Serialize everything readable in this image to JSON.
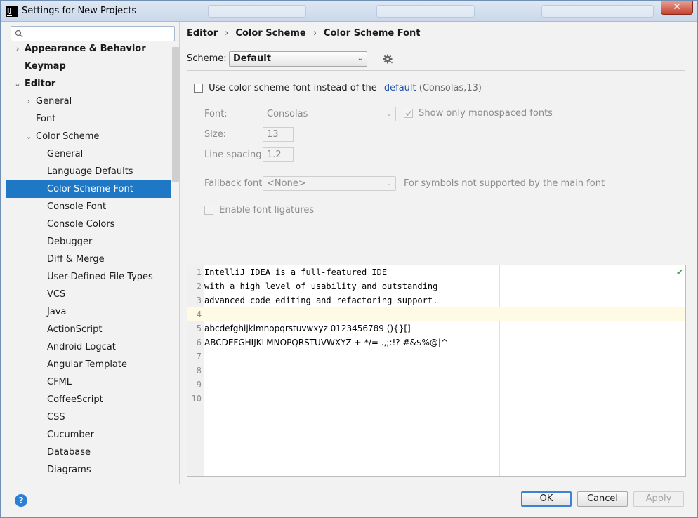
{
  "window": {
    "title": "Settings for New Projects",
    "close_glyph": "✕"
  },
  "search": {
    "placeholder": "",
    "icon": "search-icon"
  },
  "tree": [
    {
      "label": "Appearance & Behavior",
      "level": 1,
      "bold": true,
      "chevron": "›",
      "expanded": false
    },
    {
      "label": "Keymap",
      "level": 1,
      "bold": true,
      "chevron": "",
      "expanded": false
    },
    {
      "label": "Editor",
      "level": 1,
      "bold": true,
      "chevron": "⌄",
      "expanded": true
    },
    {
      "label": "General",
      "level": 2,
      "bold": false,
      "chevron": "›",
      "expanded": false
    },
    {
      "label": "Font",
      "level": 2,
      "bold": false,
      "chevron": "",
      "expanded": false
    },
    {
      "label": "Color Scheme",
      "level": 2,
      "bold": false,
      "chevron": "⌄",
      "expanded": true
    },
    {
      "label": "General",
      "level": 3,
      "bold": false,
      "chevron": ""
    },
    {
      "label": "Language Defaults",
      "level": 3,
      "bold": false,
      "chevron": ""
    },
    {
      "label": "Color Scheme Font",
      "level": 3,
      "bold": false,
      "chevron": "",
      "selected": true
    },
    {
      "label": "Console Font",
      "level": 3,
      "bold": false,
      "chevron": ""
    },
    {
      "label": "Console Colors",
      "level": 3,
      "bold": false,
      "chevron": ""
    },
    {
      "label": "Debugger",
      "level": 3,
      "bold": false,
      "chevron": ""
    },
    {
      "label": "Diff & Merge",
      "level": 3,
      "bold": false,
      "chevron": ""
    },
    {
      "label": "User-Defined File Types",
      "level": 3,
      "bold": false,
      "chevron": ""
    },
    {
      "label": "VCS",
      "level": 3,
      "bold": false,
      "chevron": ""
    },
    {
      "label": "Java",
      "level": 3,
      "bold": false,
      "chevron": ""
    },
    {
      "label": "ActionScript",
      "level": 3,
      "bold": false,
      "chevron": ""
    },
    {
      "label": "Android Logcat",
      "level": 3,
      "bold": false,
      "chevron": ""
    },
    {
      "label": "Angular Template",
      "level": 3,
      "bold": false,
      "chevron": ""
    },
    {
      "label": "CFML",
      "level": 3,
      "bold": false,
      "chevron": ""
    },
    {
      "label": "CoffeeScript",
      "level": 3,
      "bold": false,
      "chevron": ""
    },
    {
      "label": "CSS",
      "level": 3,
      "bold": false,
      "chevron": ""
    },
    {
      "label": "Cucumber",
      "level": 3,
      "bold": false,
      "chevron": ""
    },
    {
      "label": "Database",
      "level": 3,
      "bold": false,
      "chevron": ""
    },
    {
      "label": "Diagrams",
      "level": 3,
      "bold": false,
      "chevron": ""
    }
  ],
  "breadcrumb": {
    "items": [
      "Editor",
      "Color Scheme",
      "Color Scheme Font"
    ],
    "separator": "›"
  },
  "scheme": {
    "label": "Scheme:",
    "value": "Default",
    "arrow": "⌄"
  },
  "use_scheme_font": {
    "checked": false,
    "label": "Use color scheme font instead of the",
    "link": "default",
    "suffix": "(Consolas,13)"
  },
  "font": {
    "label": "Font:",
    "value": "Consolas",
    "arrow": "⌄"
  },
  "show_mono": {
    "checked": true,
    "label": "Show only monospaced fonts"
  },
  "size": {
    "label": "Size:",
    "value": "13"
  },
  "line_spacing": {
    "label": "Line spacing:",
    "value": "1.2"
  },
  "fallback": {
    "label": "Fallback font:",
    "value": "<None>",
    "arrow": "⌄",
    "hint": "For symbols not supported by the main font"
  },
  "ligatures": {
    "checked": false,
    "label": "Enable font ligatures"
  },
  "preview": {
    "lines": [
      {
        "n": "1",
        "text": "IntelliJ IDEA is a full-featured IDE"
      },
      {
        "n": "2",
        "text": "with a high level of usability and outstanding"
      },
      {
        "n": "3",
        "text": "advanced code editing and refactoring support."
      },
      {
        "n": "4",
        "text": ""
      },
      {
        "n": "5",
        "text": "abcdefghijklmnopqrstuvwxyz 0123456789 (){}[]"
      },
      {
        "n": "6",
        "text": "ABCDEFGHIJKLMNOPQRSTUVWXYZ +-*/= .,;:!? #&$%@|^"
      },
      {
        "n": "7",
        "text": ""
      },
      {
        "n": "8",
        "text": ""
      },
      {
        "n": "9",
        "text": ""
      },
      {
        "n": "10",
        "text": ""
      }
    ],
    "status_glyph": "✔"
  },
  "buttons": {
    "help": "?",
    "ok": "OK",
    "cancel": "Cancel",
    "apply": "Apply"
  }
}
